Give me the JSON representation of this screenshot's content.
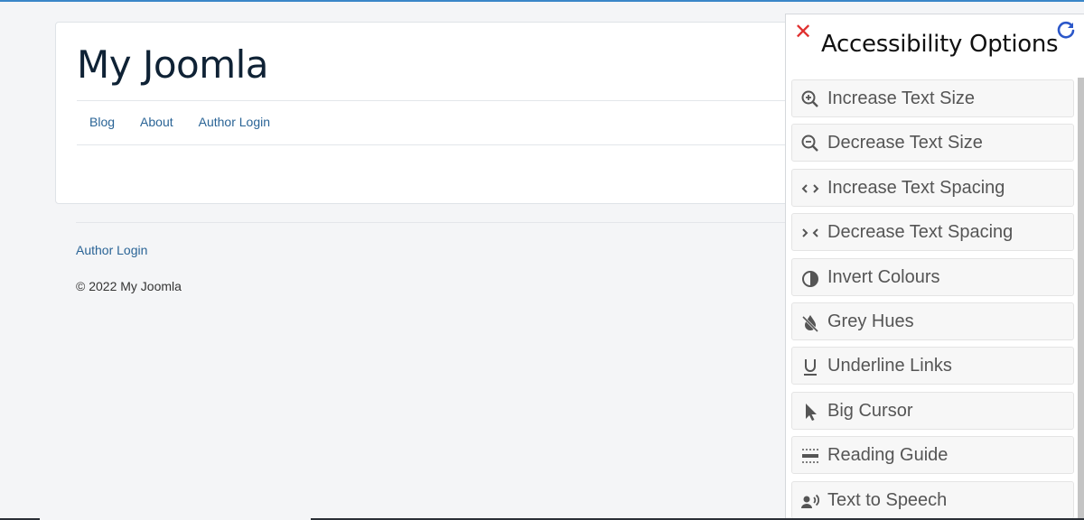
{
  "site": {
    "title": "My Joomla",
    "nav": [
      "Blog",
      "About",
      "Author Login"
    ],
    "footer_link": "Author Login",
    "copyright": "© 2022 My Joomla"
  },
  "panel": {
    "title": "Accessibility Options",
    "close_icon": "close-icon",
    "reset_icon": "refresh-icon",
    "options": [
      {
        "label": "Increase Text Size",
        "icon": "zoom-in-icon"
      },
      {
        "label": "Decrease Text Size",
        "icon": "zoom-out-icon"
      },
      {
        "label": "Increase Text Spacing",
        "icon": "expand-spacing-icon"
      },
      {
        "label": "Decrease Text Spacing",
        "icon": "contract-spacing-icon"
      },
      {
        "label": "Invert Colours",
        "icon": "contrast-icon"
      },
      {
        "label": "Grey Hues",
        "icon": "no-color-drop-icon"
      },
      {
        "label": "Underline Links",
        "icon": "underline-icon"
      },
      {
        "label": "Big Cursor",
        "icon": "cursor-icon"
      },
      {
        "label": "Reading Guide",
        "icon": "reading-guide-icon"
      },
      {
        "label": "Text to Speech",
        "icon": "speaker-person-icon"
      }
    ]
  },
  "colors": {
    "accent": "#3a86c8",
    "link": "#2a6496",
    "close": "#e0302f",
    "reset": "#2b57c9"
  }
}
